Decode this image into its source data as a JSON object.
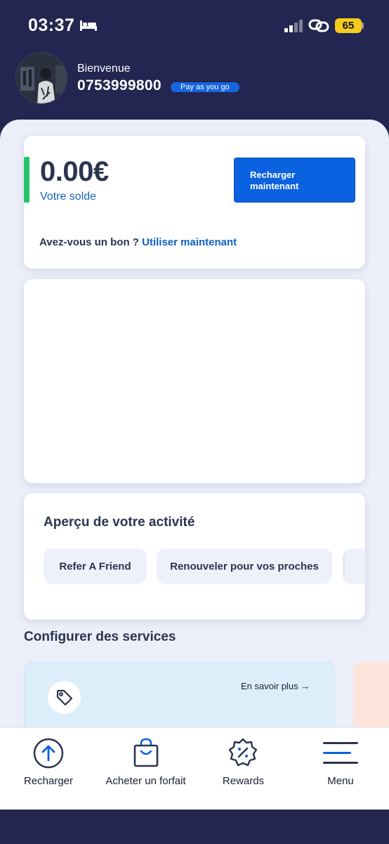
{
  "status_bar": {
    "time": "03:37",
    "battery": "65"
  },
  "header": {
    "welcome": "Bienvenue",
    "phone_number": "0753999800",
    "plan_badge": "Pay as you go"
  },
  "balance_card": {
    "amount": "0.00€",
    "label": "Votre solde",
    "recharge_button": "Recharger maintenant",
    "voucher_question": "Avez-vous un bon ?",
    "voucher_link": "Utiliser maintenant"
  },
  "activity": {
    "title": "Aperçu de votre activité",
    "chips": [
      "Refer A Friend",
      "Renouveler pour vos proches"
    ]
  },
  "services": {
    "title": "Configurer des services",
    "learn_more": "En savoir plus →"
  },
  "bottom_nav": {
    "items": [
      {
        "label": "Recharger",
        "icon": "arrow-up-circle-icon"
      },
      {
        "label": "Acheter un forfait",
        "icon": "shopping-bag-icon"
      },
      {
        "label": "Rewards",
        "icon": "percent-badge-icon"
      },
      {
        "label": "Menu",
        "icon": "menu-icon"
      }
    ]
  },
  "colors": {
    "header_bg": "#232650",
    "accent_blue": "#0a62e0",
    "balance_accent": "#22c56a",
    "text_dark": "#2b3450"
  }
}
